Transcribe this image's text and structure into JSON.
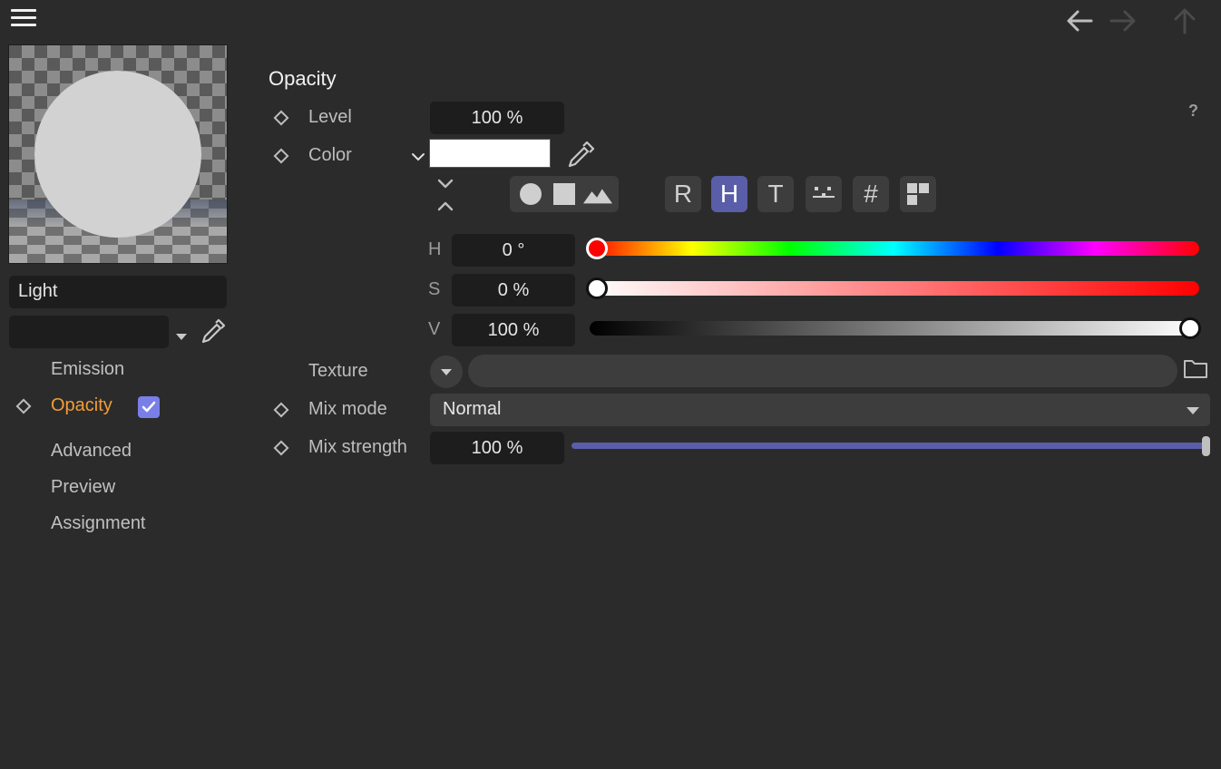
{
  "nav": {
    "menu_icon": "hamburger-menu-icon",
    "back_icon": "arrow-left-icon",
    "forward_icon": "arrow-right-icon",
    "up_icon": "arrow-up-icon"
  },
  "material": {
    "name": "Light",
    "layer_value": ""
  },
  "sidebar": {
    "items": [
      {
        "label": "Emission"
      },
      {
        "label": "Opacity",
        "checked": true,
        "active": true
      },
      {
        "label": "Advanced"
      },
      {
        "label": "Preview"
      },
      {
        "label": "Assignment"
      }
    ]
  },
  "panel": {
    "title": "Opacity",
    "help": "?",
    "level": {
      "label": "Level",
      "value": "100 %"
    },
    "color": {
      "label": "Color",
      "swatch": "#ffffff"
    },
    "modes": [
      "circle-icon",
      "square-icon",
      "mountains-icon"
    ],
    "spaces": [
      "R",
      "H",
      "T",
      "#"
    ],
    "active_space": "H",
    "hsv": {
      "h": {
        "label": "H",
        "value": "0 °",
        "fraction": 0.0
      },
      "s": {
        "label": "S",
        "value": "0 %",
        "fraction": 0.0
      },
      "v": {
        "label": "V",
        "value": "100 %",
        "fraction": 1.0
      }
    },
    "texture": {
      "label": "Texture",
      "value": ""
    },
    "mix_mode": {
      "label": "Mix mode",
      "value": "Normal"
    },
    "mix_strength": {
      "label": "Mix strength",
      "value": "100 %",
      "fraction": 1.0
    }
  },
  "colors": {
    "accent": "#5a5ea8",
    "active_nav": "#f29d38",
    "checkbox": "#7a7fe8"
  }
}
